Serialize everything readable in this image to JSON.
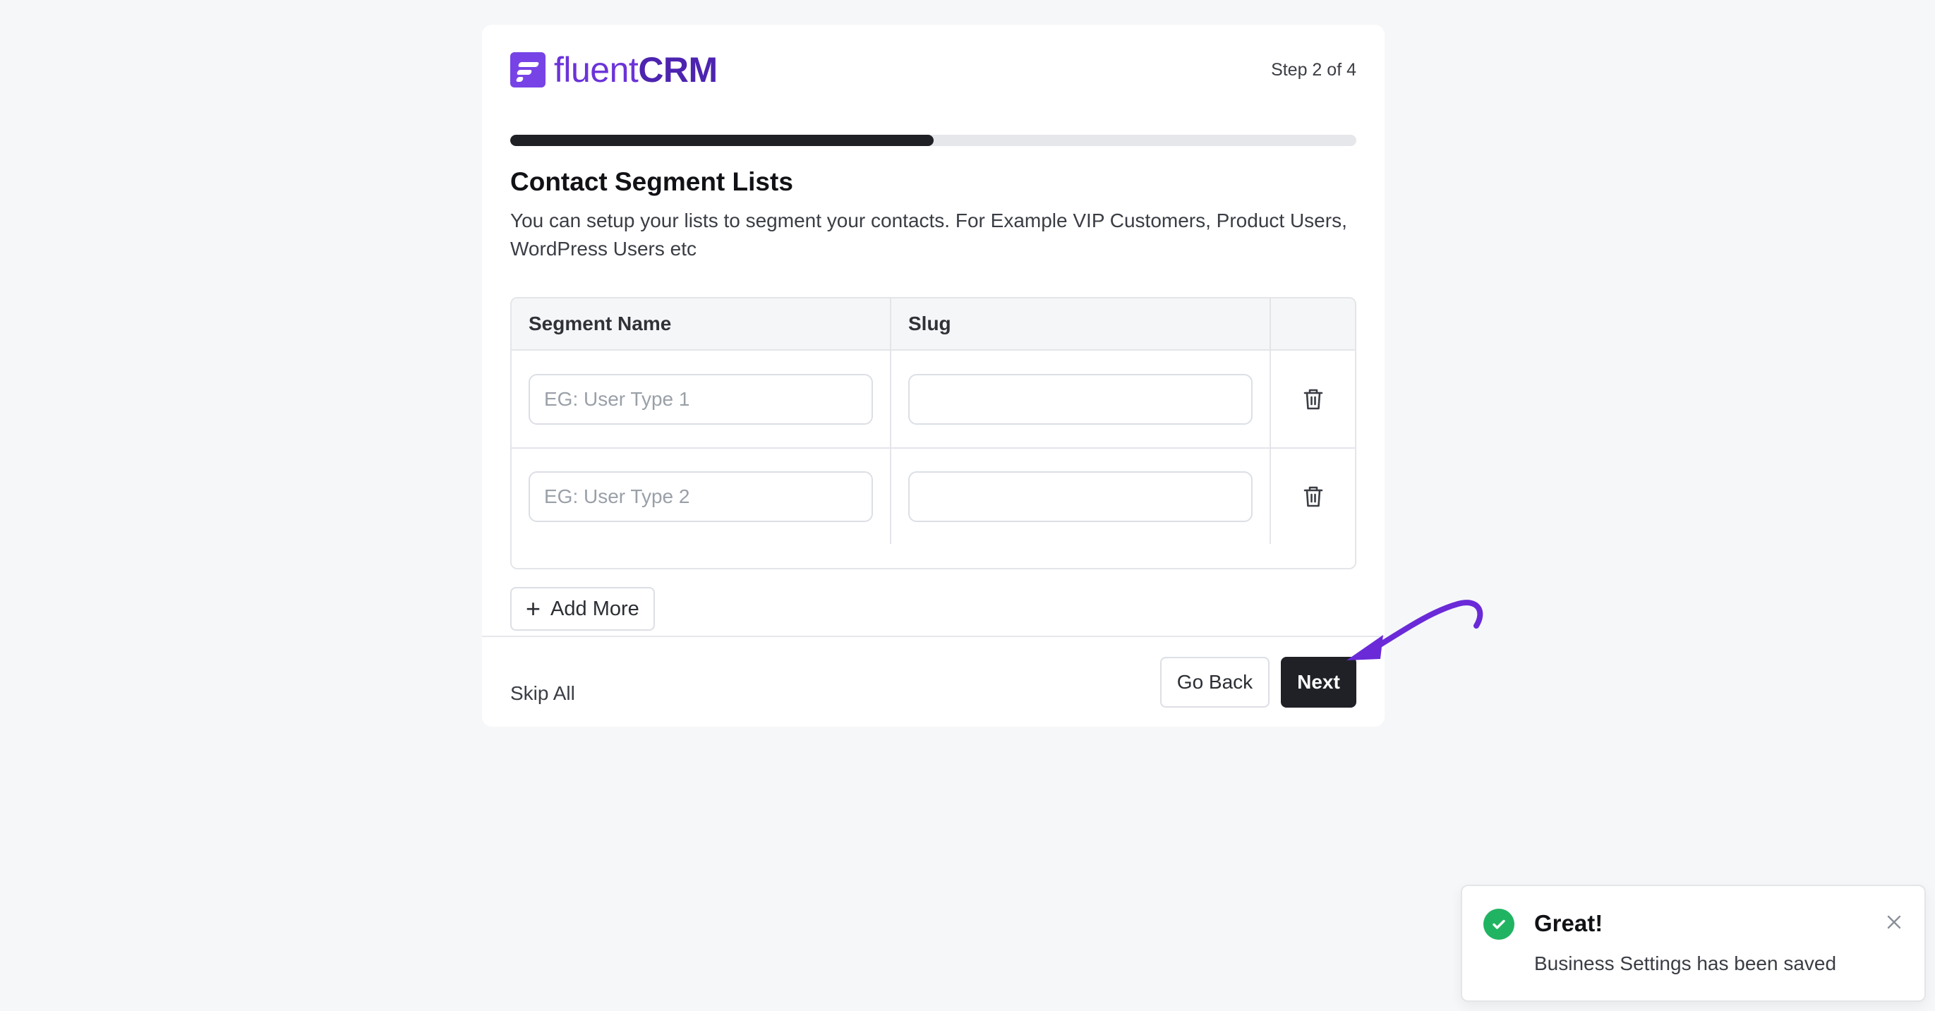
{
  "header": {
    "logo_light": "fluent",
    "logo_bold": "CRM",
    "step_text": "Step 2 of 4",
    "progress_percent": 50
  },
  "section": {
    "title": "Contact Segment Lists",
    "description": "You can setup your lists to segment your contacts. For Example VIP Customers, Product Users, WordPress Users etc"
  },
  "table": {
    "columns": [
      "Segment Name",
      "Slug",
      ""
    ],
    "rows": [
      {
        "name_value": "",
        "name_placeholder": "EG: User Type 1",
        "slug_value": ""
      },
      {
        "name_value": "",
        "name_placeholder": "EG: User Type 2",
        "slug_value": ""
      }
    ]
  },
  "actions": {
    "add_more": "Add More",
    "skip_all": "Skip All",
    "go_back": "Go Back",
    "next": "Next"
  },
  "toast": {
    "title": "Great!",
    "message": "Business Settings has been saved"
  },
  "colors": {
    "brand": "#7743e6",
    "success": "#20b462",
    "primary_button": "#1f2127",
    "annotation_arrow": "#6a2ad8"
  },
  "icons": {
    "logo": "fluentcrm-logo-icon",
    "delete": "trash-icon",
    "add": "plus-icon",
    "success": "check-circle-icon",
    "close": "close-icon"
  }
}
